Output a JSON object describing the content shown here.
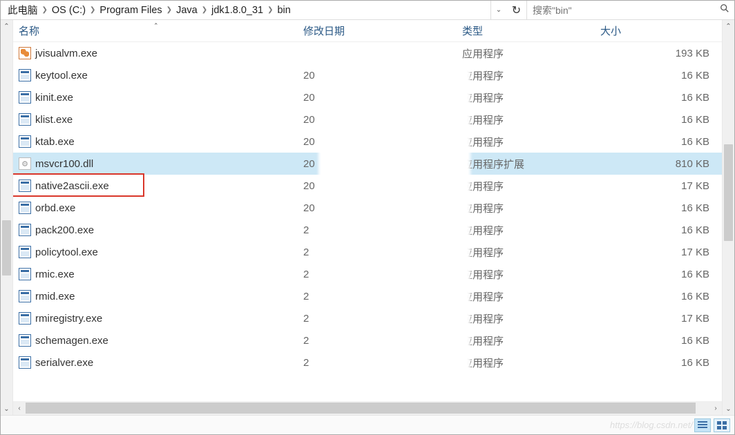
{
  "breadcrumb": [
    "此电脑",
    "OS (C:)",
    "Program Files",
    "Java",
    "jdk1.8.0_31",
    "bin"
  ],
  "search": {
    "placeholder": "搜索\"bin\""
  },
  "columns": {
    "name": "名称",
    "date": "修改日期",
    "type": "类型",
    "size": "大小"
  },
  "type_labels": {
    "app": "应用程序",
    "ext": "应用程序扩展"
  },
  "files": [
    {
      "name": "jvisualvm.exe",
      "date": "",
      "type": "app",
      "size": "193 KB",
      "icon": "jvm"
    },
    {
      "name": "keytool.exe",
      "date": "20",
      "type": "app",
      "size": "16 KB",
      "icon": "exe"
    },
    {
      "name": "kinit.exe",
      "date": "20",
      "type": "app",
      "size": "16 KB",
      "icon": "exe"
    },
    {
      "name": "klist.exe",
      "date": "20",
      "type": "app",
      "size": "16 KB",
      "icon": "exe"
    },
    {
      "name": "ktab.exe",
      "date": "20",
      "type": "app",
      "size": "16 KB",
      "icon": "exe"
    },
    {
      "name": "msvcr100.dll",
      "date": "20",
      "type": "ext",
      "size": "810 KB",
      "icon": "dll",
      "selected": true
    },
    {
      "name": "native2ascii.exe",
      "date": "20",
      "type": "app",
      "size": "17 KB",
      "icon": "exe",
      "boxed": true
    },
    {
      "name": "orbd.exe",
      "date": "20",
      "type": "app",
      "size": "16 KB",
      "icon": "exe"
    },
    {
      "name": "pack200.exe",
      "date": "2",
      "type": "app",
      "size": "16 KB",
      "icon": "exe"
    },
    {
      "name": "policytool.exe",
      "date": "2",
      "type": "app",
      "size": "17 KB",
      "icon": "exe"
    },
    {
      "name": "rmic.exe",
      "date": "2",
      "type": "app",
      "size": "16 KB",
      "icon": "exe"
    },
    {
      "name": "rmid.exe",
      "date": "2",
      "type": "app",
      "size": "16 KB",
      "icon": "exe"
    },
    {
      "name": "rmiregistry.exe",
      "date": "2",
      "type": "app",
      "size": "17 KB",
      "icon": "exe"
    },
    {
      "name": "schemagen.exe",
      "date": "2",
      "type": "app",
      "size": "16 KB",
      "icon": "exe"
    },
    {
      "name": "serialver.exe",
      "date": "2",
      "type": "app",
      "size": "16 KB",
      "icon": "exe"
    }
  ],
  "watermark": "https://blog.csdn.net/"
}
